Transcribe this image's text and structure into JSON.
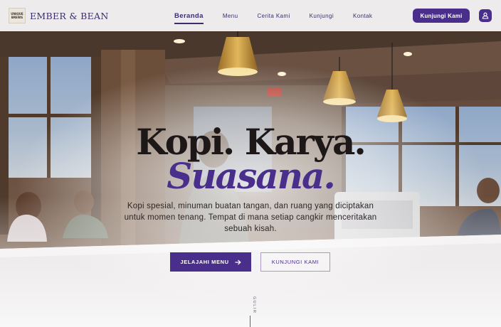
{
  "brand": {
    "logo_text": "EMBER & BEAN",
    "logo_mark_lines": [
      "UNIQUE",
      "BREWS"
    ]
  },
  "nav": {
    "items": [
      {
        "label": "Beranda",
        "active": true
      },
      {
        "label": "Menu",
        "active": false
      },
      {
        "label": "Cerita Kami",
        "active": false
      },
      {
        "label": "Kunjungi",
        "active": false
      },
      {
        "label": "Kontak",
        "active": false
      }
    ]
  },
  "header": {
    "cta_label": "Kunjungi Kami",
    "account_icon": "user-icon"
  },
  "hero": {
    "title_line1": "Kopi. Karya.",
    "title_line2": "Suasana.",
    "description": "Kopi spesial, minuman buatan tangan, dan ruang yang diciptakan untuk momen tenang. Tempat di mana setiap cangkir menceritakan sebuah kisah.",
    "primary_button": "JELAJAHI MENU",
    "primary_button_icon": "arrow-right-icon",
    "secondary_button": "KUNJUNGI KAMI",
    "scroll_label": "GULIR"
  },
  "colors": {
    "accent": "#4a2e8c",
    "heading": "#1d1717"
  }
}
